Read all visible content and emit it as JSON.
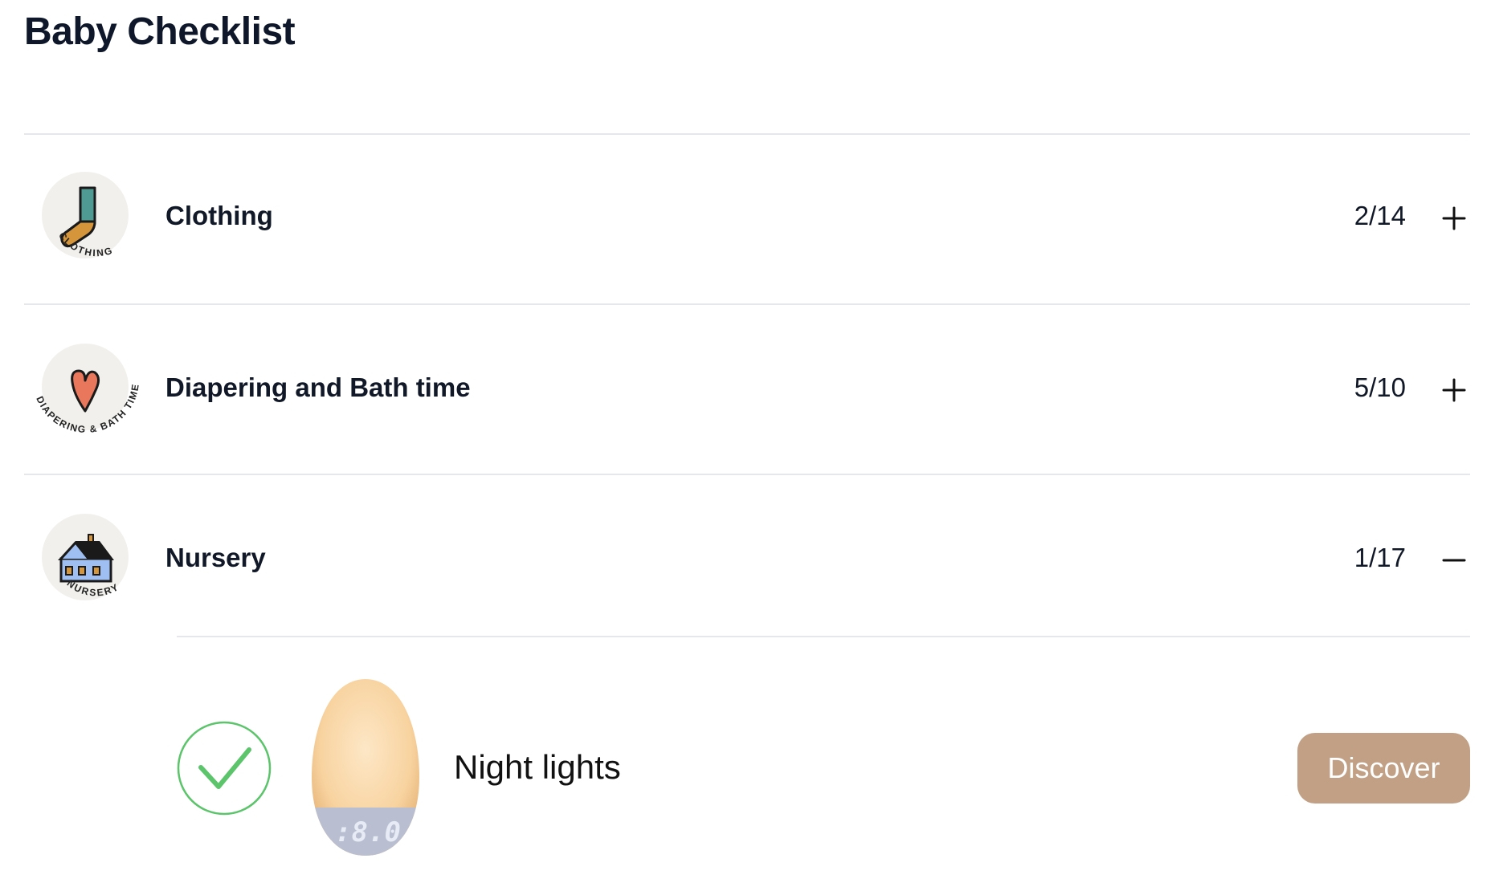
{
  "page": {
    "title": "Baby Checklist"
  },
  "categories": [
    {
      "name": "Clothing",
      "count": "2/14",
      "badge_text": "CLOTHING",
      "icon": "sock-icon",
      "toggle": "plus-icon",
      "expanded": false
    },
    {
      "name": "Diapering and Bath time",
      "count": "5/10",
      "badge_text": "DIAPERING & BATH TIME",
      "icon": "heart-icon",
      "toggle": "plus-icon",
      "expanded": false
    },
    {
      "name": "Nursery",
      "count": "1/17",
      "badge_text": "NURSERY",
      "icon": "house-icon",
      "toggle": "minus-icon",
      "expanded": true
    }
  ],
  "nursery_items": [
    {
      "name": "Night lights",
      "checked": true,
      "product_display": ":8.0",
      "action_label": "Discover"
    }
  ],
  "colors": {
    "check_green": "#5cc46b",
    "discover_button": "#c1a085",
    "badge_bg": "#f1f0ec",
    "divider": "#e5e7eb"
  }
}
